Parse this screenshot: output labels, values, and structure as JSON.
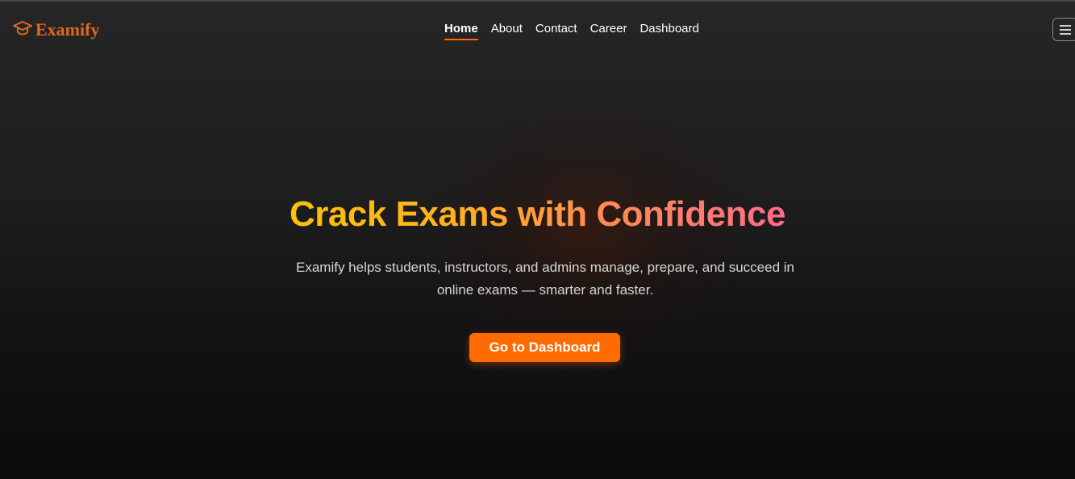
{
  "brand": {
    "name": "Examify",
    "icon": "graduation-cap-icon",
    "color": "#e1691f"
  },
  "nav": {
    "items": [
      {
        "label": "Home",
        "active": true
      },
      {
        "label": "About",
        "active": false
      },
      {
        "label": "Contact",
        "active": false
      },
      {
        "label": "Career",
        "active": false
      },
      {
        "label": "Dashboard",
        "active": false
      }
    ],
    "menu_icon": "hamburger-menu-icon"
  },
  "hero": {
    "title": "Crack Exams with Confidence",
    "subtitle": "Examify helps students, instructors, and admins manage, prepare, and succeed in online exams — smarter and faster.",
    "cta_label": "Go to Dashboard"
  },
  "colors": {
    "accent": "#ff6b00",
    "title_gradient_start": "#ffc107",
    "title_gradient_end": "#ff6b8b"
  }
}
